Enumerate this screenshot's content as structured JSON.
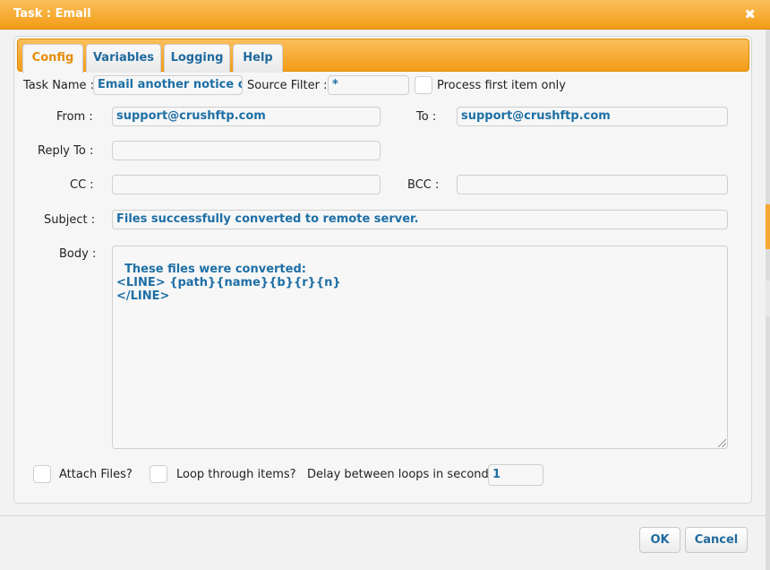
{
  "window": {
    "title": "Task : Email",
    "close_icon": "✖"
  },
  "tabs": [
    {
      "label": "Config",
      "active": true
    },
    {
      "label": "Variables",
      "active": false
    },
    {
      "label": "Logging",
      "active": false
    },
    {
      "label": "Help",
      "active": false
    }
  ],
  "form": {
    "task_name": {
      "label": "Task Name :",
      "value": "Email another notice of c"
    },
    "source_filter": {
      "label": "Source Filter :",
      "value": "*"
    },
    "process_first": {
      "label": "Process first item only",
      "checked": false
    },
    "from": {
      "label": "From :",
      "value": "support@crushftp.com"
    },
    "to": {
      "label": "To :",
      "value": "support@crushftp.com"
    },
    "reply_to": {
      "label": "Reply To :",
      "value": ""
    },
    "cc": {
      "label": "CC :",
      "value": ""
    },
    "bcc": {
      "label": "BCC :",
      "value": ""
    },
    "subject": {
      "label": "Subject :",
      "value": "Files successfully converted to remote server."
    },
    "body": {
      "label": "Body :",
      "value": "These files were converted:\n<LINE> {path}{name}{b}{r}{n}\n</LINE>"
    },
    "attach_files": {
      "label": "Attach Files?",
      "checked": false
    },
    "loop_items": {
      "label": "Loop through items?",
      "checked": false
    },
    "delay": {
      "label": "Delay between loops in seconds :",
      "value": "1"
    }
  },
  "buttons": {
    "ok": "OK",
    "cancel": "Cancel"
  },
  "colors": {
    "accent": "#f39c16",
    "link": "#1f6a9e",
    "active_tab": "#e58c0a"
  }
}
